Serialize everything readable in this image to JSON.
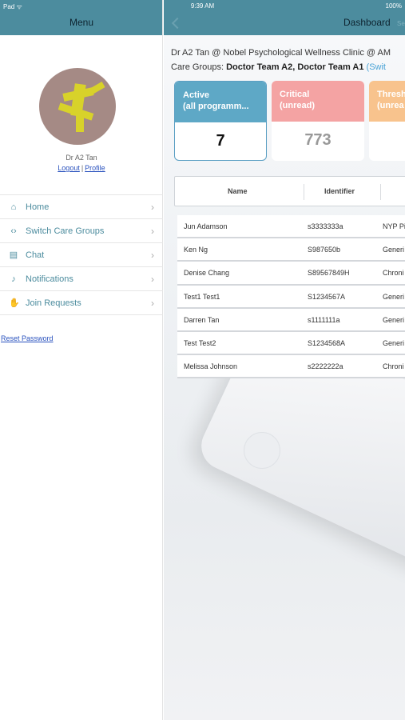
{
  "status_bar": {
    "device": "Pad ᯤ",
    "time": "9:39 AM",
    "battery": "100%"
  },
  "menu": {
    "title": "Menu",
    "user_name": "Dr A2 Tan",
    "logout_label": "Logout",
    "separator": "|",
    "profile_label": "Profile",
    "items": [
      {
        "label": "Home",
        "icon": "home-icon",
        "glyph": "⌂"
      },
      {
        "label": "Switch Care Groups",
        "icon": "switch-icon",
        "glyph": "‹›"
      },
      {
        "label": "Chat",
        "icon": "chat-icon",
        "glyph": "▤"
      },
      {
        "label": "Notifications",
        "icon": "bell-icon",
        "glyph": "♪"
      },
      {
        "label": "Join Requests",
        "icon": "hand-icon",
        "glyph": "✋"
      }
    ],
    "chevron": "›",
    "reset_password_label": "Reset Password"
  },
  "dashboard": {
    "title": "Dashboard",
    "extra": "Se",
    "clinic_line": "Dr A2 Tan @ Nobel Psychological Wellness Clinic @ AM",
    "care_groups_prefix": "Care Groups: ",
    "care_groups": "Doctor Team A2, Doctor Team A1",
    "switch_label": "(Swit",
    "cards": [
      {
        "title": "Active\n(all programm...",
        "value": "7"
      },
      {
        "title": "Critical\n(unread)",
        "value": "773"
      },
      {
        "title": "Thresh\n(unrea",
        "value": ""
      }
    ],
    "columns": [
      "Name",
      "Identifier"
    ],
    "rows": [
      {
        "name": "Jun Adamson",
        "identifier": "s3333333a",
        "program": "NYP Pi"
      },
      {
        "name": "Ken Ng",
        "identifier": "S987650b",
        "program": "Generi"
      },
      {
        "name": "Denise Chang",
        "identifier": "S89567849H",
        "program": "Chroni"
      },
      {
        "name": "Test1 Test1",
        "identifier": "S1234567A",
        "program": "Generi"
      },
      {
        "name": "Darren Tan",
        "identifier": "s1111111a",
        "program": "Generi"
      },
      {
        "name": "Test Test2",
        "identifier": "S1234568A",
        "program": "Generi"
      },
      {
        "name": "Melissa Johnson",
        "identifier": "s2222222a",
        "program": "Chroni"
      }
    ]
  },
  "colors": {
    "header": "#4c8c9e",
    "menu_accent": "#4c8c9e",
    "link": "#2a52be",
    "active_card": "#5ea8c6",
    "critical_card": "#f4a3a3",
    "threshold_card": "#f8c38d"
  }
}
